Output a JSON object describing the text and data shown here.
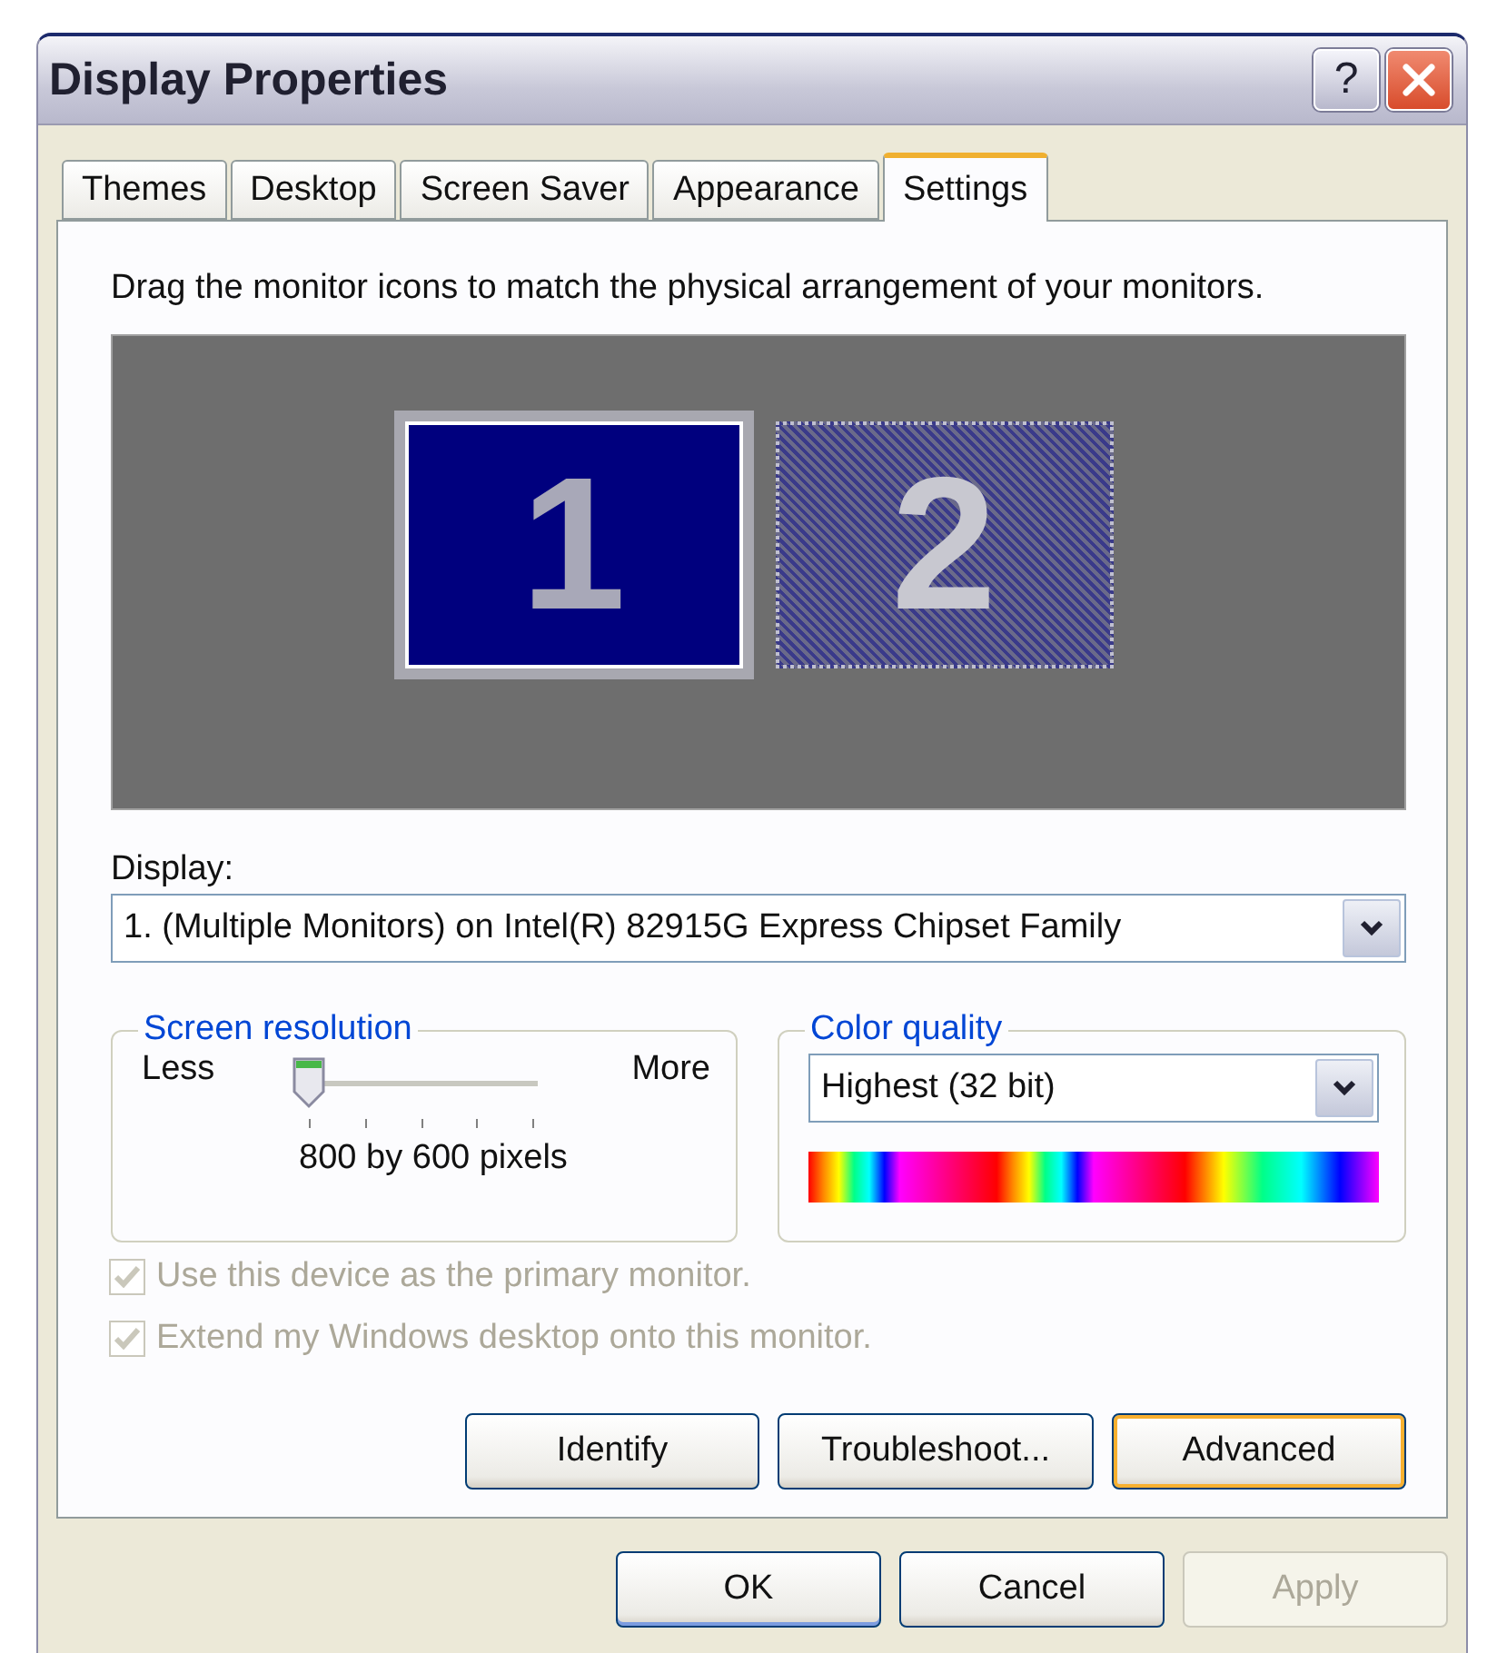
{
  "window": {
    "title": "Display Properties",
    "help": "?"
  },
  "tabs": [
    {
      "label": "Themes",
      "selected": false
    },
    {
      "label": "Desktop",
      "selected": false
    },
    {
      "label": "Screen Saver",
      "selected": false
    },
    {
      "label": "Appearance",
      "selected": false
    },
    {
      "label": "Settings",
      "selected": true
    }
  ],
  "instruction": "Drag the monitor icons to match the physical arrangement of your monitors.",
  "monitors": [
    {
      "label": "1",
      "selected": true,
      "active": true
    },
    {
      "label": "2",
      "selected": false,
      "active": false
    }
  ],
  "display": {
    "label": "Display:",
    "value": "1. (Multiple Monitors) on Intel(R) 82915G Express Chipset Family"
  },
  "resolution": {
    "title": "Screen resolution",
    "less": "Less",
    "more": "More",
    "level": 0,
    "reading": "800 by 600 pixels"
  },
  "color_quality": {
    "title": "Color quality",
    "value": "Highest (32 bit)"
  },
  "checkboxes": [
    {
      "label": "Use this device as the primary monitor.",
      "checked": true,
      "disabled": true
    },
    {
      "label": "Extend my Windows desktop onto this monitor.",
      "checked": true,
      "disabled": true
    }
  ],
  "panel_buttons": [
    {
      "label": "Identify",
      "focused": false
    },
    {
      "label": "Troubleshoot...",
      "focused": false
    },
    {
      "label": "Advanced",
      "focused": true
    }
  ],
  "dialog_buttons": [
    {
      "label": "OK",
      "disabled": false,
      "default": true
    },
    {
      "label": "Cancel",
      "disabled": false,
      "default": false
    },
    {
      "label": "Apply",
      "disabled": true,
      "default": false
    }
  ]
}
